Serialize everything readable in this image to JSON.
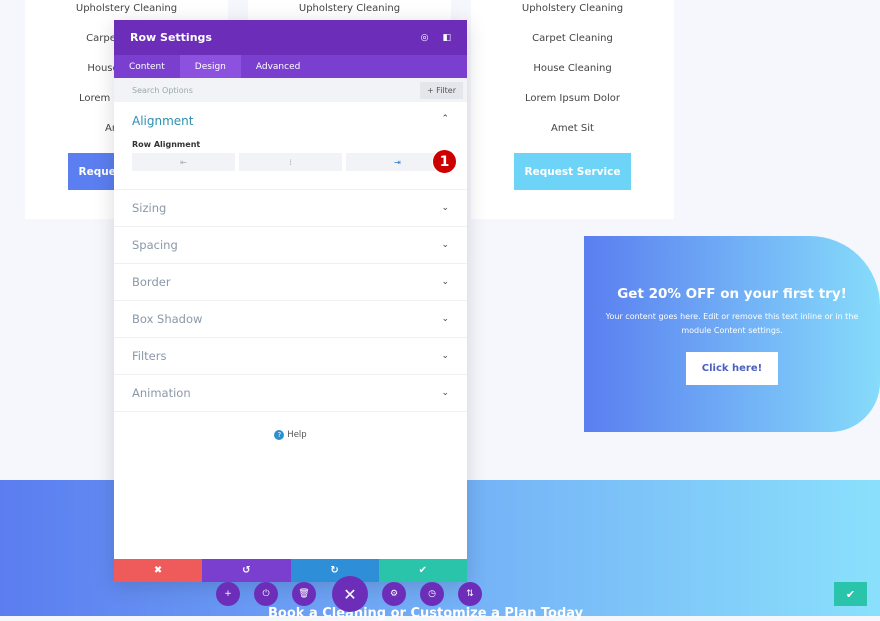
{
  "cards": [
    {
      "items": [
        "Upholstery Cleaning",
        "Carpet Cleaning",
        "House Cleaning",
        "Lorem Ipsum Dolor",
        "Amet Sit"
      ],
      "button": "Request Service"
    },
    {
      "items": [
        "Upholstery Cleaning"
      ]
    },
    {
      "items": [
        "Upholstery Cleaning",
        "Carpet Cleaning",
        "House Cleaning",
        "Lorem Ipsum Dolor",
        "Amet Sit"
      ],
      "button": "Request Service"
    }
  ],
  "promo": {
    "title": "Get 20% OFF on your first try!",
    "text": "Your content goes here. Edit or remove this text inline or in the module Content settings.",
    "button": "Click here!"
  },
  "bottom": {
    "tagline": "Book a Cleaning or Customize a Plan Today"
  },
  "modal": {
    "title": "Row Settings",
    "tabs": [
      "Content",
      "Design",
      "Advanced"
    ],
    "active_tab": "Design",
    "search_placeholder": "Search Options",
    "filter": "+ Filter",
    "alignment": {
      "title": "Alignment",
      "label": "Row Alignment",
      "selected": "right"
    },
    "sections": [
      "Sizing",
      "Spacing",
      "Border",
      "Box Shadow",
      "Filters",
      "Animation"
    ],
    "help": "Help",
    "badge": "1"
  },
  "colors": {
    "purple": "#6c2eb9",
    "red": "#ef5a5a",
    "blue": "#2e8fd8",
    "green": "#29c4a9"
  }
}
